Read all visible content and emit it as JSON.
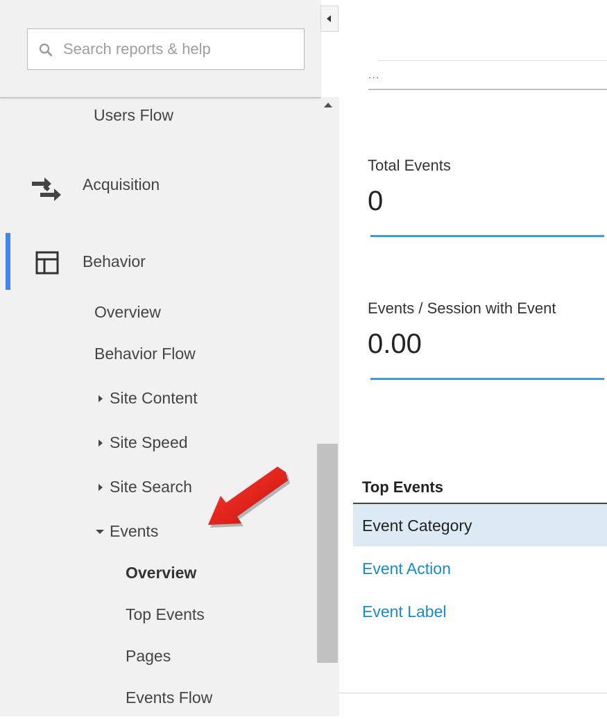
{
  "search": {
    "placeholder": "Search reports & help"
  },
  "sidebar": {
    "users_flow": "Users Flow",
    "acquisition": "Acquisition",
    "behavior": "Behavior",
    "behavior_items": {
      "overview": "Overview",
      "behavior_flow": "Behavior Flow",
      "site_content": "Site Content",
      "site_speed": "Site Speed",
      "site_search": "Site Search",
      "events": "Events"
    },
    "events_items": {
      "overview": "Overview",
      "top_events": "Top Events",
      "pages": "Pages",
      "events_flow": "Events Flow"
    }
  },
  "main": {
    "dots": "...",
    "metrics": [
      {
        "label": "Total Events",
        "value": "0"
      },
      {
        "label": "Events / Session with Event",
        "value": "0.00"
      }
    ],
    "top_events": {
      "title": "Top Events",
      "rows": [
        "Event Category",
        "Event Action",
        "Event Label"
      ]
    }
  },
  "colors": {
    "accent": "#4285f4",
    "link": "#1a8ac7",
    "sparkline": "#3b9fd3",
    "selected_row": "#dceaf3",
    "annotation_arrow": "#e0201b"
  },
  "icons": {
    "search": "search-icon",
    "acquisition": "acquisition-arrows-icon",
    "behavior": "behavior-layout-icon"
  }
}
